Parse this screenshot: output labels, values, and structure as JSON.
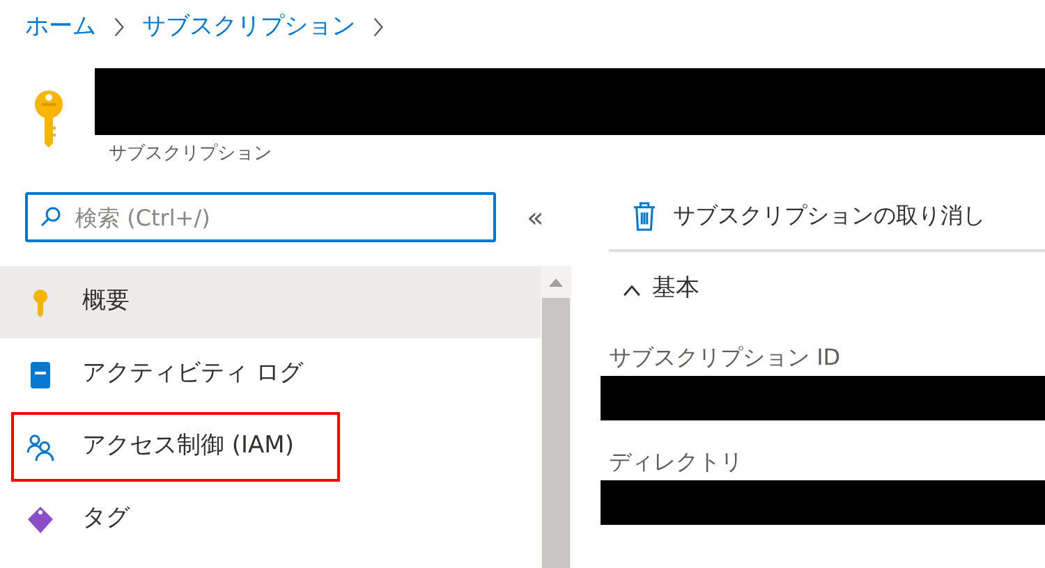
{
  "breadcrumb": [
    {
      "label": "ホーム"
    },
    {
      "label": "サブスクリプション"
    }
  ],
  "header": {
    "subtitle": "サブスクリプション"
  },
  "search": {
    "placeholder": "検索 (Ctrl+/)"
  },
  "collapse_button": "«",
  "menu": [
    {
      "label": "概要",
      "kind": "key",
      "selected": true,
      "highlighted": false
    },
    {
      "label": "アクティビティ ログ",
      "kind": "log",
      "selected": false,
      "highlighted": false
    },
    {
      "label": "アクセス制御 (IAM)",
      "kind": "people",
      "selected": false,
      "highlighted": true
    },
    {
      "label": "タグ",
      "kind": "tag",
      "selected": false,
      "highlighted": false
    }
  ],
  "toolbar": [
    {
      "label": "サブスクリプションの取り消し",
      "kind": "delete"
    }
  ],
  "section": {
    "title": "基本",
    "expanded": true
  },
  "fields": [
    {
      "label": "サブスクリプション ID"
    },
    {
      "label": "ディレクトリ"
    }
  ]
}
